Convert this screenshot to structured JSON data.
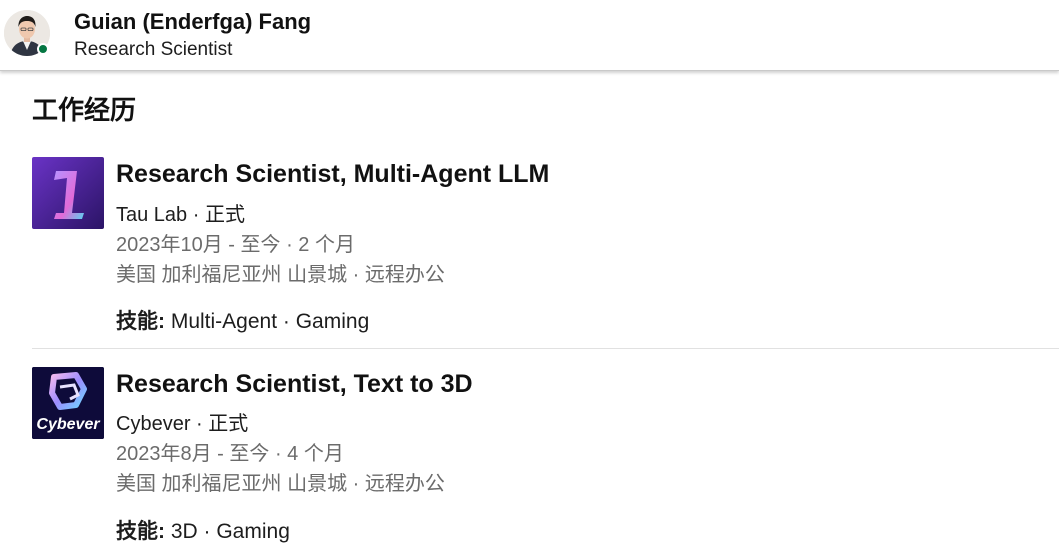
{
  "profile": {
    "name": "Guian (Enderfga) Fang",
    "headline": "Research Scientist",
    "status_color": "#057642"
  },
  "section": {
    "title": "工作经历"
  },
  "experiences": [
    {
      "title": "Research Scientist, Multi-Agent LLM",
      "company_line": "Tau Lab · 正式",
      "dates": "2023年10月 - 至今 · 2 个月",
      "location": "美国 加利福尼亚州 山景城 · 远程办公",
      "skills_label": "技能:",
      "skills": "Multi-Agent · Gaming",
      "logo_icon": "tau-lab-logo"
    },
    {
      "title": "Research Scientist, Text to 3D",
      "company_line": "Cybever · 正式",
      "dates": "2023年8月 - 至今 · 4 个月",
      "location": "美国 加利福尼亚州 山景城 · 远程办公",
      "skills_label": "技能:",
      "skills": "3D · Gaming",
      "logo_icon": "cybever-logo",
      "logo_text": "Cybever"
    }
  ]
}
